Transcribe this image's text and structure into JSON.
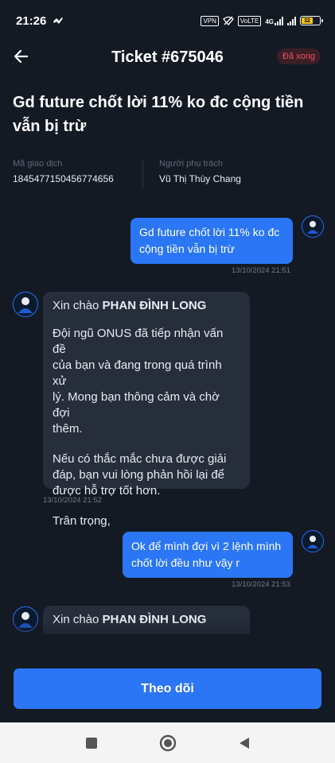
{
  "status_bar": {
    "time": "21:26",
    "vpn": "VPN",
    "network_4g": "4G",
    "volte": "VoLTE",
    "battery": "32"
  },
  "header": {
    "title": "Ticket #675046",
    "status_badge": "Đã xong"
  },
  "ticket": {
    "subject": "Gd future chốt lời 11% ko đc cộng tiền vẫn bị trừ",
    "transaction_label": "Mã giao dịch",
    "transaction_id": "1845477150456774656",
    "assignee_label": "Người phụ trách",
    "assignee_name": "Vũ Thị Thùy Chang"
  },
  "messages": [
    {
      "direction": "out",
      "lines": [
        "Gd future chốt lời 11% ko đc",
        "cộng tiền vẫn bị trừ"
      ],
      "time": "13/10/2024 21:51"
    },
    {
      "direction": "in",
      "greeting": "Xin chào ",
      "name": "PHAN ĐÌNH LONG",
      "p1": [
        "Đội ngũ ONUS đã tiếp nhận vấn đề",
        "của bạn và đang trong quá trình xử",
        "lý. Mong bạn thông cảm và chờ đợi",
        "thêm."
      ],
      "p2": [
        "Nếu có thắc mắc chưa được giải",
        "đáp, bạn vui lòng phản hồi lại để",
        "được hỗ trợ tốt hơn."
      ],
      "p3": "Trân trọng,",
      "time": "13/10/2024 21:52"
    },
    {
      "direction": "out",
      "lines": [
        "Ok để mình đợi vì 2 lệnh mình",
        "chốt lời đều như vậy r"
      ],
      "time": "13/10/2024 21:53"
    },
    {
      "direction": "in",
      "greeting": "Xin chào ",
      "name": "PHAN ĐÌNH LONG"
    }
  ],
  "action": {
    "follow_label": "Theo dõi"
  },
  "icons": {
    "back": "arrow-left-icon",
    "nav_recents": "square-icon",
    "nav_home": "circle-icon",
    "nav_back": "triangle-left-icon"
  },
  "colors": {
    "background": "#141a24",
    "accent": "#2b76f5",
    "incoming_bubble": "#262d3b",
    "badge_text": "#f0506e"
  }
}
